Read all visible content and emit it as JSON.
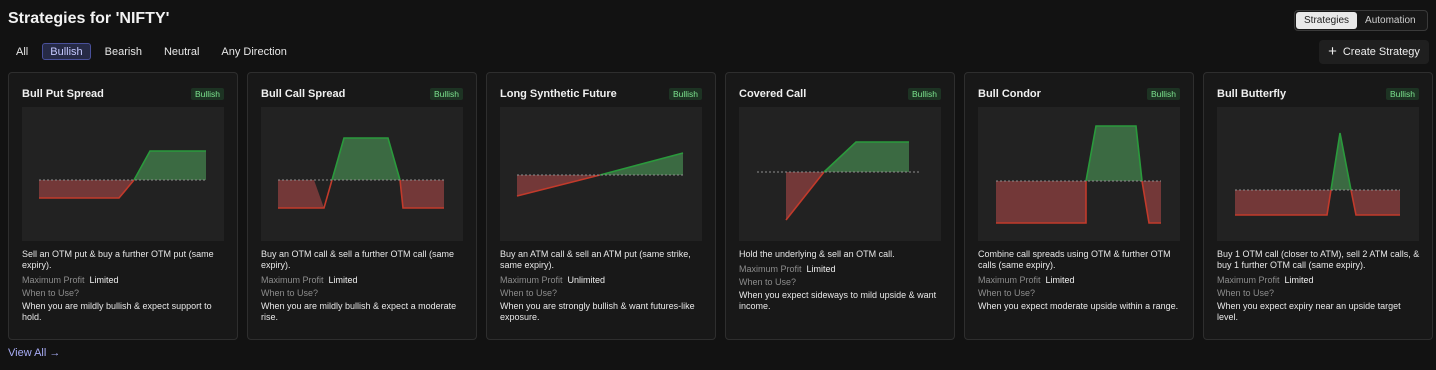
{
  "header": {
    "title": "Strategies for 'NIFTY'"
  },
  "tabs": [
    "Strategies",
    "Automation"
  ],
  "filters": [
    "All",
    "Bullish",
    "Bearish",
    "Neutral",
    "Any Direction"
  ],
  "create_label": "Create Strategy",
  "view_all": "View All",
  "colors": {
    "profit": "#2a9a3c",
    "loss": "#c23a2b",
    "accent": "#49509a"
  },
  "labels": {
    "max_profit": "Maximum Profit",
    "when": "When to Use?"
  },
  "cards": [
    {
      "name": "Bull Put Spread",
      "badge": "Bullish",
      "desc": "Sell an OTM put & buy a further OTM put (same expiry).",
      "max_profit": "Limited",
      "when": "When you are mildly bullish & expect support to hold."
    },
    {
      "name": "Bull Call Spread",
      "badge": "Bullish",
      "desc": "Buy an OTM call & sell a further OTM call (same expiry).",
      "max_profit": "Limited",
      "when": "When you are mildly bullish & expect a moderate rise."
    },
    {
      "name": "Long Synthetic Future",
      "badge": "Bullish",
      "desc": "Buy an ATM call & sell an ATM put (same strike, same expiry).",
      "max_profit": "Unlimited",
      "when": "When you are strongly bullish & want futures-like exposure."
    },
    {
      "name": "Covered Call",
      "badge": "Bullish",
      "desc": "Hold the underlying & sell an OTM call.",
      "max_profit": "Limited",
      "when": "When you expect sideways to mild upside & want income."
    },
    {
      "name": "Bull Condor",
      "badge": "Bullish",
      "desc": "Combine call spreads using OTM & further OTM calls (same expiry).",
      "max_profit": "Limited",
      "when": "When you expect moderate upside within a range."
    },
    {
      "name": "Bull Butterfly",
      "badge": "Bullish",
      "desc": "Buy 1 OTM call (closer to ATM), sell 2 ATM calls, & buy 1 further OTM call (same expiry).",
      "max_profit": "Limited",
      "when": "When you expect expiry near an upside target level."
    }
  ]
}
